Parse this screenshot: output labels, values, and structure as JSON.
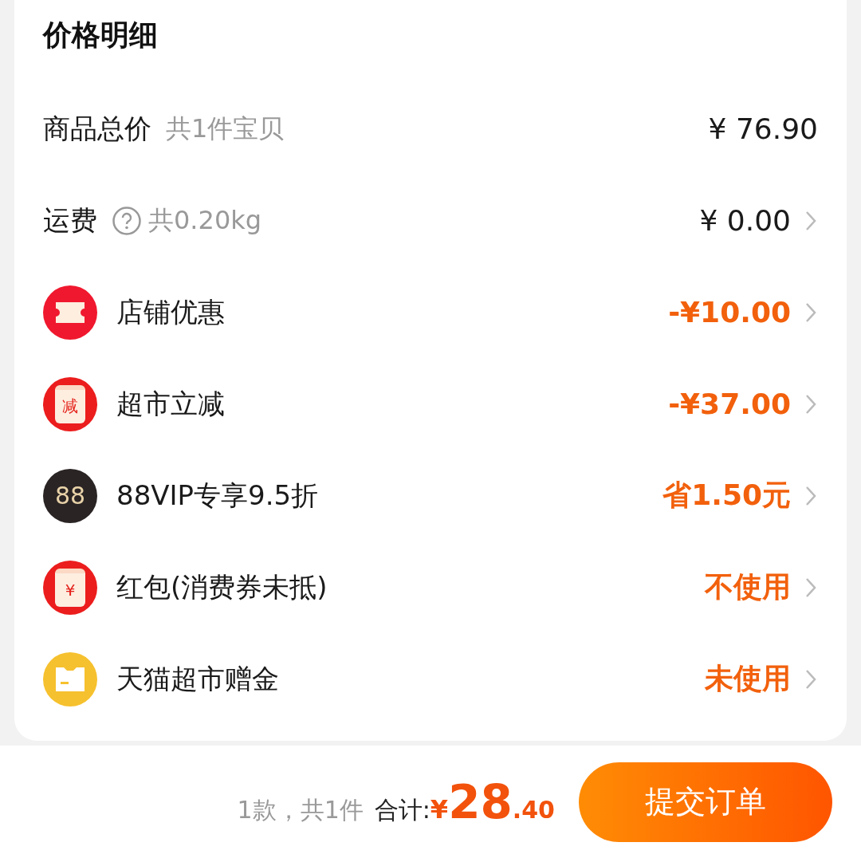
{
  "section_title": "价格明细",
  "rows": [
    {
      "kind": "plain",
      "label": "商品总价",
      "note": "共1件宝贝",
      "help": false,
      "value": "¥ 76.90",
      "highlight": false,
      "arrow": false
    },
    {
      "kind": "plain",
      "label": "运费",
      "note": "共0.20kg",
      "help": true,
      "value": "¥ 0.00",
      "highlight": false,
      "arrow": true
    },
    {
      "kind": "ticket",
      "label": "店铺优惠",
      "value": "-¥10.00",
      "highlight": true,
      "arrow": true
    },
    {
      "kind": "envelope",
      "icon_text": "减",
      "label": "超市立减",
      "value": "-¥37.00",
      "highlight": true,
      "arrow": true
    },
    {
      "kind": "vip",
      "icon_text": "88",
      "label": "88VIP专享9.5折",
      "value": "省1.50元",
      "highlight": true,
      "arrow": true
    },
    {
      "kind": "envelope",
      "icon_text": "¥",
      "label": "红包(消费券未抵)",
      "value": "不使用",
      "highlight": true,
      "arrow": true
    },
    {
      "kind": "card",
      "label": "天猫超市赠金",
      "value": "未使用",
      "highlight": true,
      "arrow": true
    }
  ],
  "footer": {
    "count": "1款，共1件",
    "total_label": "合计:",
    "currency": "¥",
    "total_int": "28",
    "total_dec": ".40",
    "submit": "提交订单"
  }
}
